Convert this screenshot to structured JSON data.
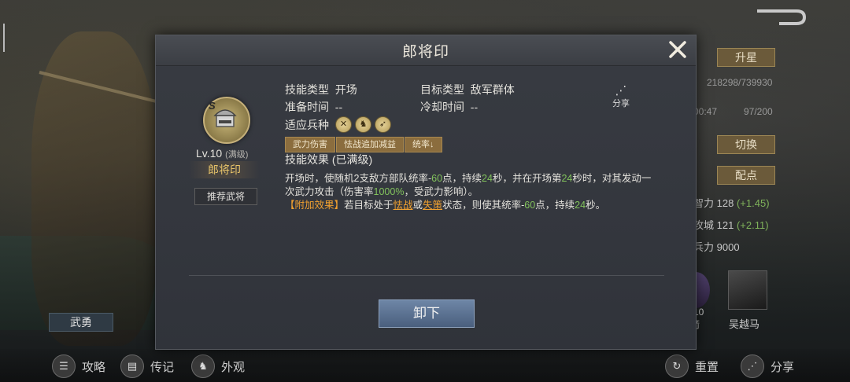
{
  "background": {
    "right_panel": {
      "star_button": "升星",
      "progress_text": "218298/739930",
      "time_text": "00:47",
      "count_text": "97/200",
      "switch_button": "切换",
      "allocate_button": "配点",
      "stats": [
        {
          "label": "智力",
          "value": "128",
          "plus": "(+1.45)"
        },
        {
          "label": "攻城",
          "value": "121",
          "plus": "(+2.11)"
        },
        {
          "label": "兵力",
          "value": "9000",
          "plus": ""
        }
      ],
      "horse_label": "吴越马",
      "round_card_text": "10",
      "round_card_sub": "箭"
    },
    "left_tag": "武勇",
    "bottom_bar": [
      {
        "label": "攻略",
        "icon": "strategy-icon"
      },
      {
        "label": "传记",
        "icon": "biography-icon"
      },
      {
        "label": "外观",
        "icon": "appearance-icon"
      },
      {
        "label": "重置",
        "icon": "reset-icon"
      },
      {
        "label": "分享",
        "icon": "share-icon"
      }
    ]
  },
  "dialog": {
    "title": "郎将印",
    "skill": {
      "grade": "S",
      "level_label": "Lv.10",
      "level_note": "(满级)",
      "name": "郎将印",
      "recommend_button": "推荐武将"
    },
    "info": {
      "skill_type_label": "技能类型",
      "skill_type_value": "开场",
      "target_type_label": "目标类型",
      "target_type_value": "敌军群体",
      "prep_time_label": "准备时间",
      "prep_time_value": "--",
      "cooldown_label": "冷却时间",
      "cooldown_value": "--",
      "troop_label": "适应兵种",
      "troop_icons": [
        "sword-icon",
        "cavalry-icon",
        "bow-icon"
      ]
    },
    "share_label": "分享",
    "tags": [
      "武力伤害",
      "怯战追加减益",
      "统率↓"
    ],
    "effect_title": "技能效果 (已满级)",
    "effect": {
      "line1_a": "开场时，使随机2支敌方部队统率-",
      "line1_v1": "60",
      "line1_b": "点，持续",
      "line1_v2": "24",
      "line1_c": "秒，并在开场第",
      "line1_v3": "24",
      "line1_d": "秒时，对其发动一次武力攻击（伤害率",
      "line1_v4": "1000%",
      "line1_e": "，受武力影响）。",
      "extra_label": "【附加效果】",
      "line2_a": "若目标处于",
      "line2_link1": "怯战",
      "line2_b": "或",
      "line2_link2": "失策",
      "line2_c": "状态，则使其统率-",
      "line2_v1": "60",
      "line2_d": "点，持续",
      "line2_v2": "24",
      "line2_e": "秒。"
    },
    "unequip_button": "卸下"
  }
}
